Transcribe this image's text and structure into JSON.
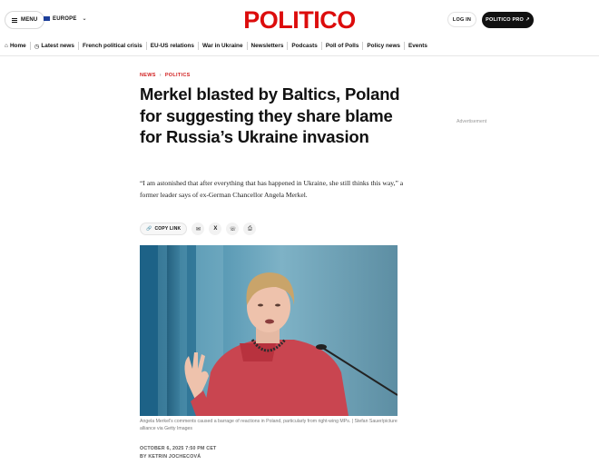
{
  "header": {
    "menu_label": "MENU",
    "edition_label": "EUROPE",
    "logo_text": "POLITICO",
    "login_label": "LOG IN",
    "pro_label": "POLITICO PRO"
  },
  "nav": {
    "items": [
      {
        "label": "Home",
        "icon": "home-icon"
      },
      {
        "label": "Latest news",
        "icon": "clock-icon"
      },
      {
        "label": "French political crisis"
      },
      {
        "label": "EU-US relations"
      },
      {
        "label": "War in Ukraine"
      },
      {
        "label": "Newsletters"
      },
      {
        "label": "Podcasts"
      },
      {
        "label": "Poll of Polls"
      },
      {
        "label": "Policy news"
      },
      {
        "label": "Events"
      }
    ]
  },
  "article": {
    "breadcrumb": [
      "NEWS",
      "POLITICS"
    ],
    "headline": "Merkel blasted by Baltics, Poland for suggesting they share blame for Russia’s Ukraine invasion",
    "dek": "“I am astonished that after everything that has happened in Ukraine, she still thinks this way,” a former leader says of ex-German Chancellor Angela Merkel.",
    "copy_link_label": "COPY LINK",
    "caption": "Angela Merkel's comments caused a barrage of reactions in Poland, particularly from right-wing MPs. | Stefan Sauer/picture alliance via Getty Images",
    "date": "OCTOBER 6, 2025 7:50 PM CET",
    "byline": "BY KETRIN JOCHECOVÁ"
  },
  "sidebar": {
    "ad_label": "Advertisement"
  },
  "colors": {
    "brand_red": "#dc0c0c",
    "crumb_red": "#d12020"
  }
}
